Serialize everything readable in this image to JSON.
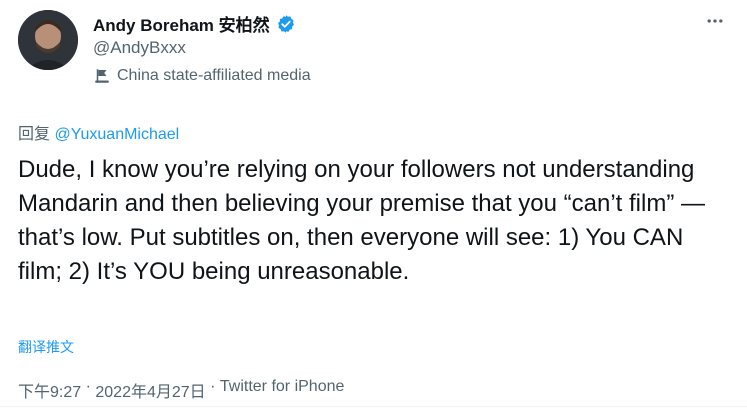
{
  "author": {
    "display_name": "Andy Boreham 安柏然",
    "handle": "@AndyBxxx",
    "affiliation_label": "China state-affiliated media",
    "verified_color": "#1d9bf0"
  },
  "reply": {
    "prefix": "回复",
    "mention": "@YuxuanMichael"
  },
  "tweet": {
    "text": "Dude, I know you’re relying on your followers not understanding Mandarin and then believing your premise that you “can’t film” — that’s low. Put subtitles on, then everyone will see: 1) You CAN film; 2) It’s YOU being unreasonable.",
    "translate_label": "翻译推文"
  },
  "meta": {
    "time": "下午9:27",
    "separator": " · ",
    "date": "2022年4月27日",
    "separator2": " · ",
    "source": "Twitter for iPhone"
  },
  "icons": {
    "more": "more-dots-icon",
    "verified": "verified-badge-icon",
    "affiliation": "state-media-flag-icon"
  }
}
